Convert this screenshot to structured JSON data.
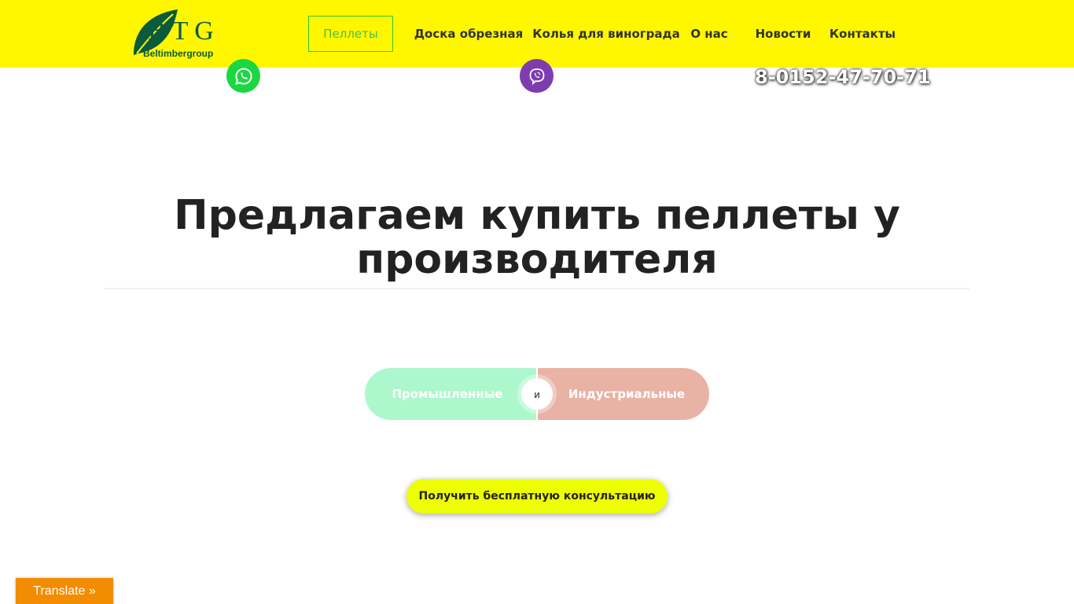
{
  "header": {
    "logo": {
      "letters": "B T G",
      "subtitle": "Beltimbergroup",
      "brand_color": "#0a5a3c"
    },
    "background_color": "#fff700",
    "nav": [
      {
        "label": "Пеллеты",
        "active": true
      },
      {
        "label": "Доска обрезная",
        "active": false
      },
      {
        "label": "Колья для винограда",
        "active": false
      },
      {
        "label": "О нас",
        "active": false
      },
      {
        "label": "Новости",
        "active": false
      },
      {
        "label": "Контакты",
        "active": false
      }
    ]
  },
  "contacts": {
    "whatsapp_icon": "whatsapp-icon",
    "viber_icon": "viber-icon",
    "phone": "8-0152-47-70-71"
  },
  "hero": {
    "title": "Предлагаем купить пеллеты у производителя",
    "split_button": {
      "left_label": "Промышленные",
      "middle_label": "и",
      "right_label": "Индустриальные",
      "left_color": "#adf7cc",
      "right_color": "#e8b2a5"
    },
    "cta_label": "Получить бесплатную консультацию",
    "cta_color": "#eeff00"
  },
  "translate": {
    "label": "Translate »",
    "color": "#f28c00"
  }
}
